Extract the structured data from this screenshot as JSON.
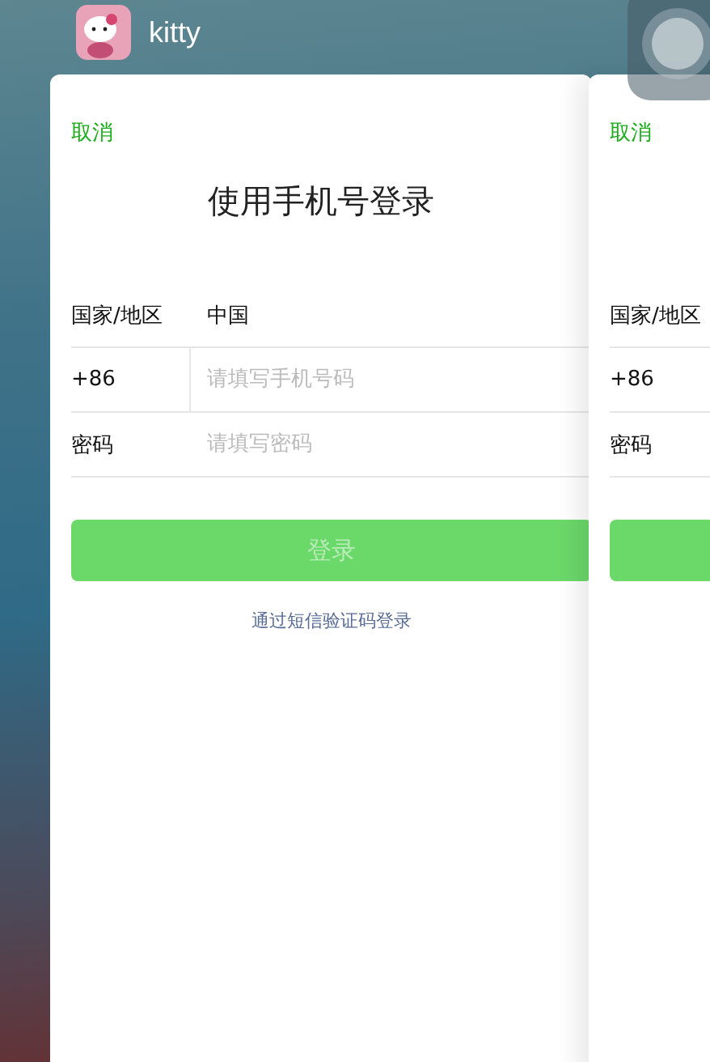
{
  "app": {
    "name": "kitty"
  },
  "cards": [
    {
      "cancel": "取消",
      "title": "使用手机号登录",
      "rows": [
        {
          "kind": "select",
          "label": "国家/地区",
          "value": "中国"
        },
        {
          "kind": "phone",
          "label": "+86",
          "placeholder": "请填写手机号码"
        },
        {
          "kind": "password",
          "label": "密码",
          "placeholder": "请填写密码"
        }
      ],
      "button": {
        "label": "登录",
        "disabled": true
      },
      "link": "通过短信验证码登录"
    },
    {
      "cancel": "取消",
      "rows": [
        {
          "kind": "select",
          "label": "国家/地区"
        },
        {
          "kind": "phone",
          "label": "+86"
        },
        {
          "kind": "password",
          "label": "密码"
        }
      ],
      "button": {
        "disabled": true
      }
    }
  ]
}
